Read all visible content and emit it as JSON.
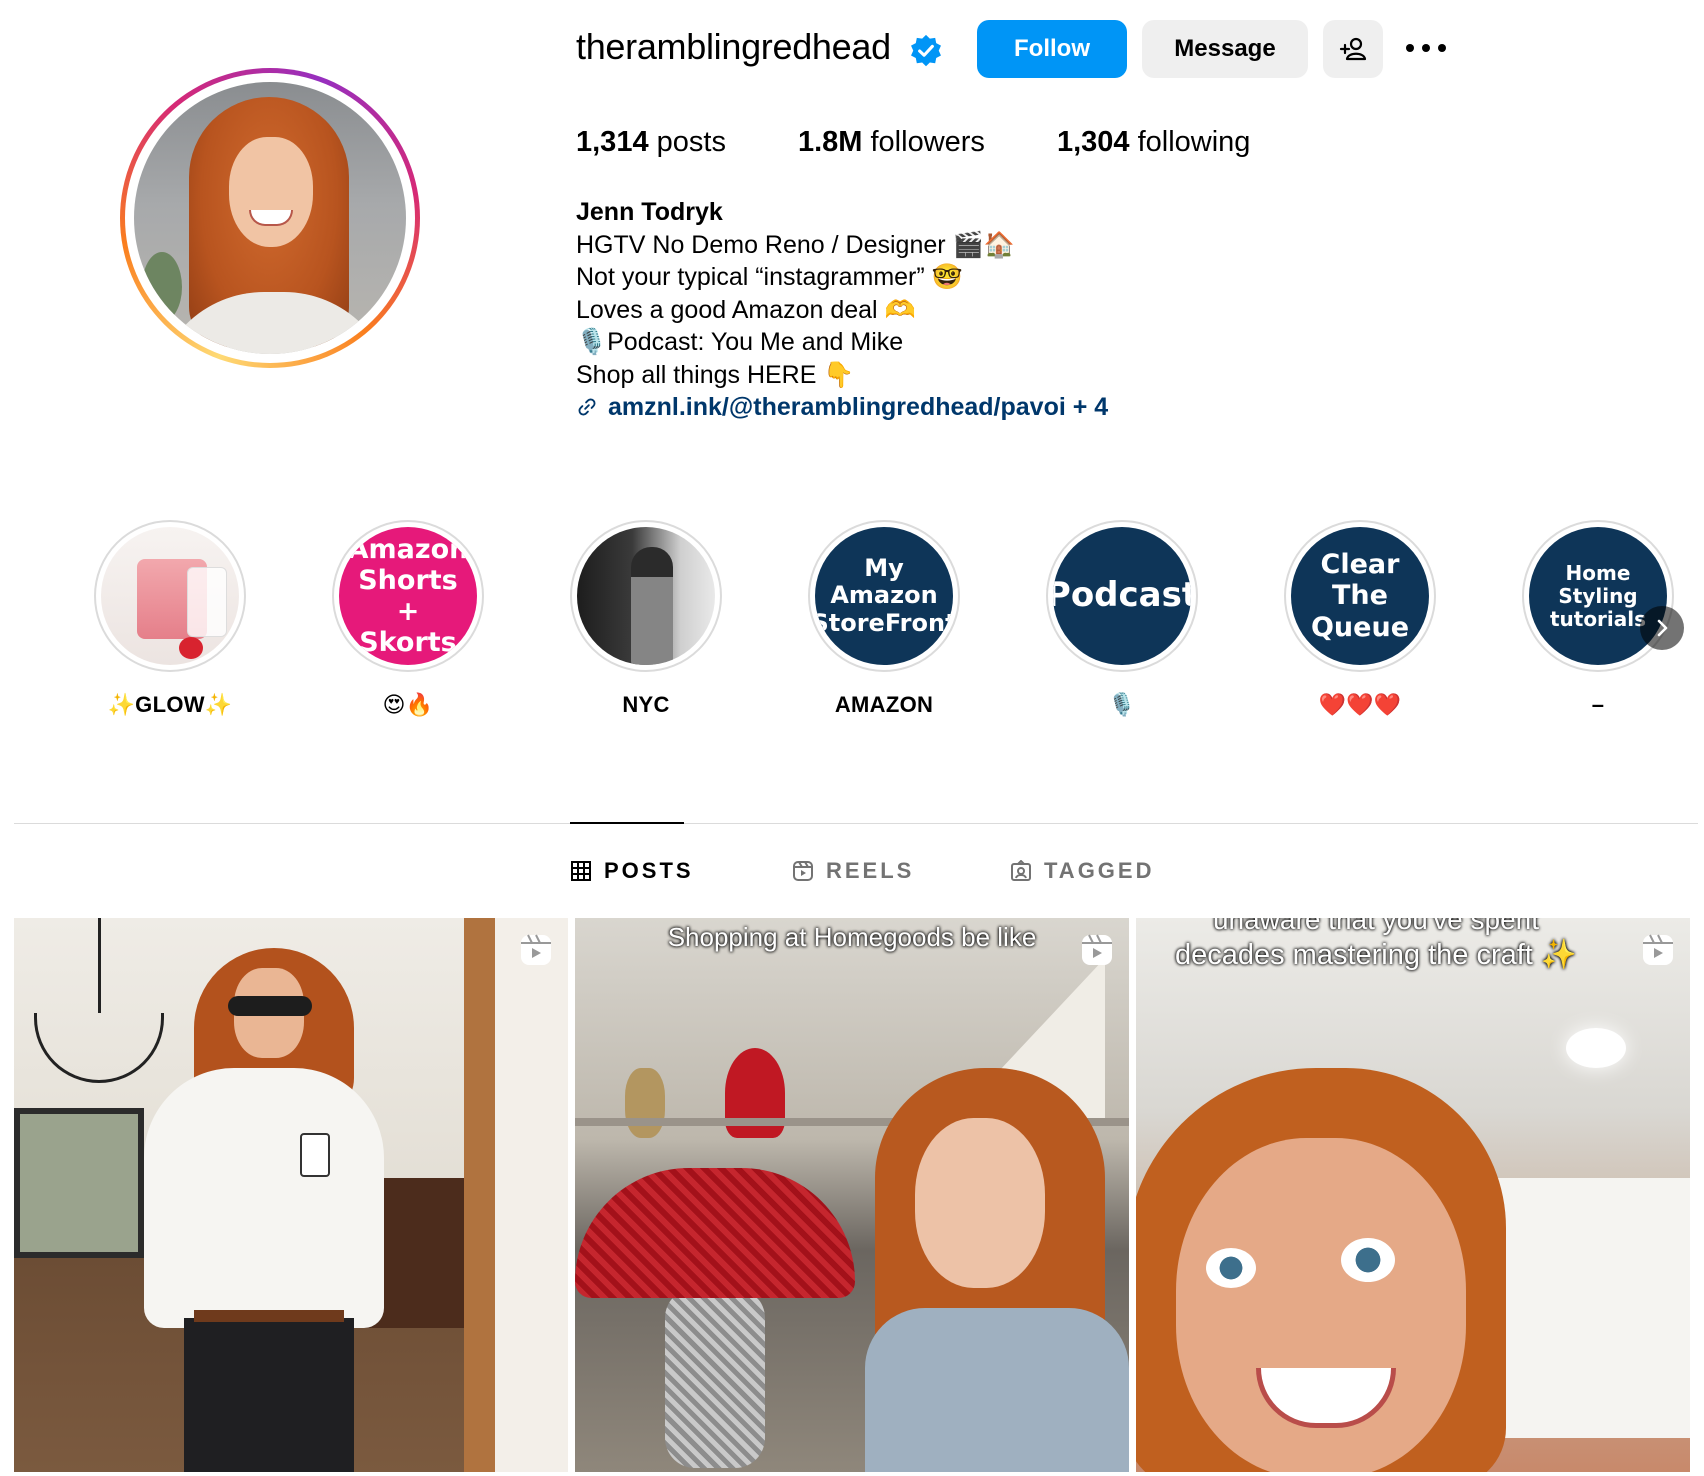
{
  "profile": {
    "username": "theramblingredhead",
    "verified": true,
    "follow_label": "Follow",
    "message_label": "Message",
    "stats": {
      "posts_count": "1,314",
      "posts_label": " posts",
      "followers_count": "1.8M",
      "followers_label": " followers",
      "following_count": "1,304",
      "following_label": " following"
    },
    "bio": {
      "name": "Jenn Todryk",
      "lines": [
        "HGTV No Demo Reno / Designer 🎬🏠",
        "Not your typical “instagrammer” 🤓",
        "Loves a good Amazon deal 🫶",
        "🎙️Podcast: You Me and Mike",
        "Shop all things HERE 👇"
      ],
      "link": "amznl.ink/@theramblingredhead/pavoi + 4"
    }
  },
  "highlights": [
    {
      "label": "✨GLOW✨",
      "cover_text": ""
    },
    {
      "label": "😍🔥",
      "cover_text": "Amazon Shorts + Skorts"
    },
    {
      "label": "NYC",
      "cover_text": ""
    },
    {
      "label": "AMAZON",
      "cover_text": "My Amazon StoreFront"
    },
    {
      "label": "🎙️",
      "cover_text": "Podcast"
    },
    {
      "label": "❤️❤️❤️",
      "cover_text": "Clear The Queue"
    },
    {
      "label": "–",
      "cover_text": "Home Styling tutorials"
    }
  ],
  "tabs": {
    "posts": "POSTS",
    "reels": "REELS",
    "tagged": "TAGGED",
    "active": "posts"
  },
  "posts": [
    {
      "overlay_text": "",
      "type": "reel"
    },
    {
      "overlay_text": "Shopping at Homegoods be like",
      "type": "reel"
    },
    {
      "overlay_text_top": "unaware that you've spent",
      "overlay_text": "decades mastering the craft ✨",
      "type": "reel"
    }
  ],
  "colors": {
    "follow_button": "#0095f6",
    "secondary_button": "#efefef",
    "link": "#00376b",
    "highlight_navy": "#0e3558",
    "highlight_pink": "#e6197a",
    "verified_badge": "#0095f6"
  },
  "icons": [
    "verified-badge-icon",
    "add-user-icon",
    "more-options-icon",
    "link-icon",
    "grid-icon",
    "reels-icon",
    "tagged-icon",
    "reel-icon",
    "chevron-right-icon"
  ]
}
